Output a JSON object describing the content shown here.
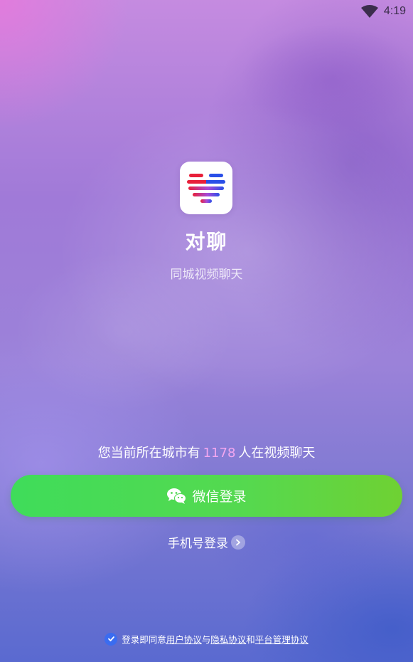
{
  "status_bar": {
    "time": "4:19",
    "icons": [
      "wifi-icon"
    ]
  },
  "app": {
    "name": "对聊",
    "slogan": "同城视频聊天",
    "logo_icon": "heart-stripes-logo"
  },
  "city_info": {
    "prefix": "您当前所在城市有",
    "count": "1178",
    "suffix": "人在视频聊天",
    "count_color": "#f3a7f0"
  },
  "wechat_login": {
    "label": "微信登录",
    "icon": "wechat-icon",
    "color_start": "#3fdc5a",
    "color_end": "#6fd133"
  },
  "phone_login": {
    "label": "手机号登录",
    "icon": "chevron-right-icon"
  },
  "agreement": {
    "checked": true,
    "prefix": "登录即同意",
    "user_agreement": "用户协议",
    "conj1": "与",
    "privacy_agreement": "隐私协议",
    "conj2": "和",
    "platform_agreement": "平台管理协议",
    "check_color": "#3a6cf0"
  }
}
